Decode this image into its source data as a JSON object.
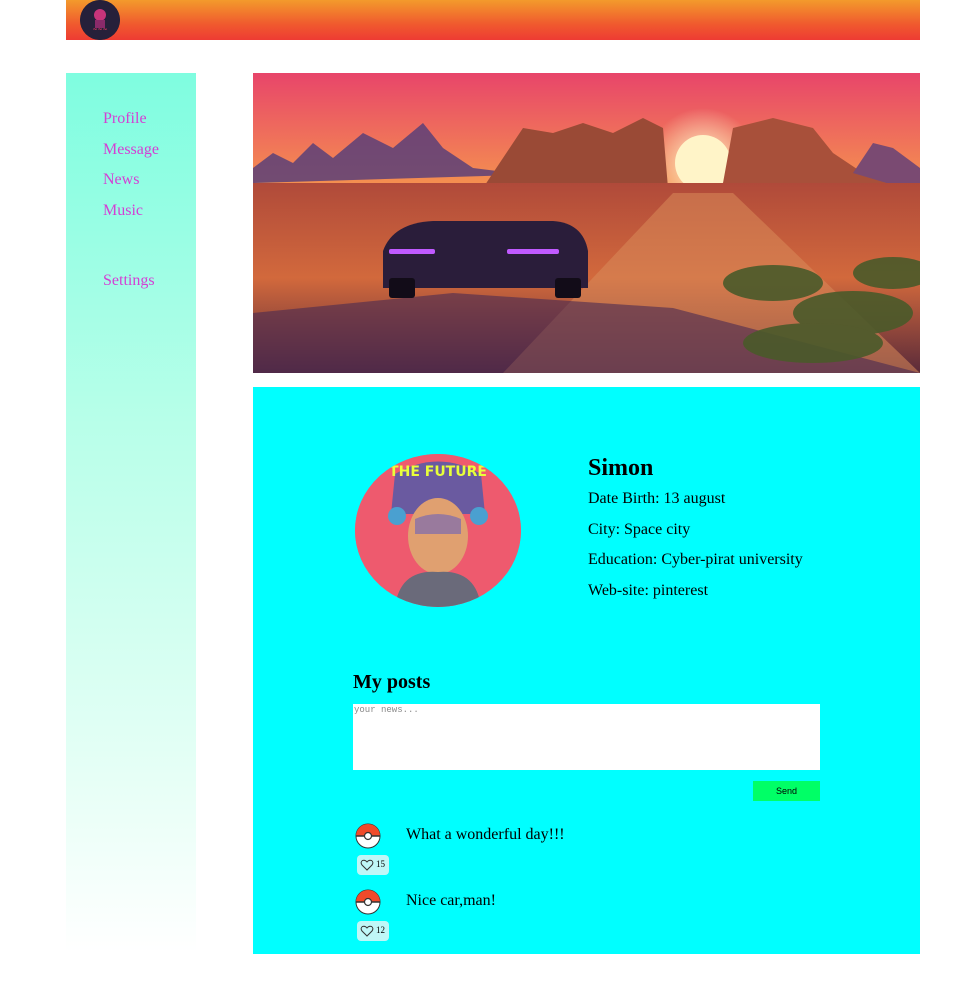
{
  "nav": {
    "items": [
      {
        "label": "Profile"
      },
      {
        "label": "Message"
      },
      {
        "label": "News"
      },
      {
        "label": "Music"
      }
    ],
    "settings": "Settings"
  },
  "profile": {
    "name": "Simon",
    "date_birth": "Date Birth: 13 august",
    "city": "City: Space city",
    "education": "Education: Cyber-pirat university",
    "website": "Web-site: pinterest",
    "avatar_caption": "THE FUTURE"
  },
  "posts": {
    "title": "My posts",
    "input_placeholder": "your news...",
    "send_label": "Send",
    "items": [
      {
        "text": "What a wonderful day!!!",
        "likes": "15"
      },
      {
        "text": "Nice car,man!",
        "likes": "12"
      }
    ]
  },
  "colors": {
    "header_gradient": [
      "#f39a2c",
      "#ee3b33"
    ],
    "sidebar_top": "#7ffde0",
    "nav_text": "#d43fd4",
    "content_bg": "#00ffff",
    "send_button": "#00ff66"
  },
  "icons": {
    "logo": "logo-icon",
    "post_avatar": "pokeball-icon",
    "like": "heart-icon"
  }
}
